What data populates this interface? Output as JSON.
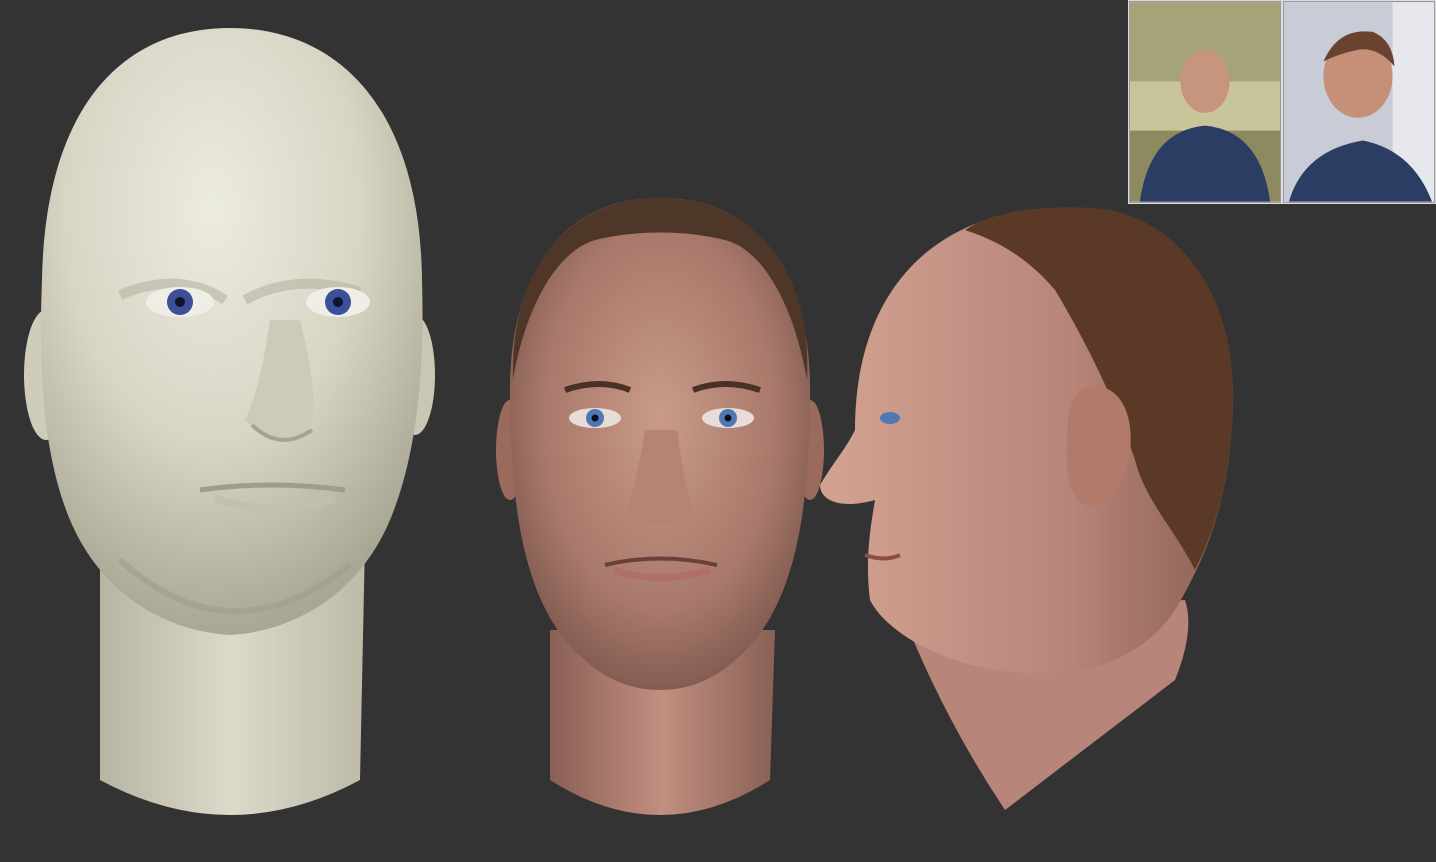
{
  "viewport": {
    "background_color": "#333333"
  },
  "renders": [
    {
      "view": "sculpt-front",
      "material": "clay",
      "color": "#d9d6c6",
      "eye_color": "#3b4f9a"
    },
    {
      "view": "textured-front",
      "material": "skin",
      "color": "#c08d7a",
      "eye_color": "#4f78b3"
    },
    {
      "view": "textured-side",
      "material": "skin",
      "color": "#c59080"
    }
  ],
  "reference_photos": [
    {
      "view": "front"
    },
    {
      "view": "profile"
    }
  ]
}
